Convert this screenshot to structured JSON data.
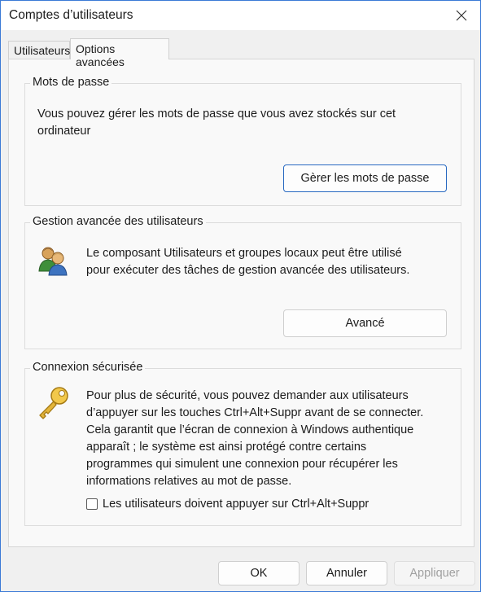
{
  "window": {
    "title": "Comptes d’utilisateurs",
    "accent_color": "#3b7ad6"
  },
  "tabs": [
    {
      "label": "Utilisateurs",
      "selected": false
    },
    {
      "label": "Options avancées",
      "selected": true
    }
  ],
  "passwords": {
    "title": "Mots de passe",
    "text_line1": "Vous pouvez gérer les mots de passe que vous avez stockés sur cet",
    "text_line2": "ordinateur",
    "button_label": "Gèrer les mots de passe"
  },
  "advanced_users": {
    "title": "Gestion avancée des utilisateurs",
    "icon": "users-group-icon",
    "text_line1": "Le composant Utilisateurs et groupes locaux peut être utilisé",
    "text_line2": "pour exécuter des tâches de gestion avancée des utilisateurs.",
    "button_label": "Avancé"
  },
  "secure_logon": {
    "title": "Connexion sécurisée",
    "icon": "key-icon",
    "text_lines": [
      "Pour plus de sécurité, vous pouvez demander aux utilisateurs",
      "d’appuyer sur les touches Ctrl+Alt+Suppr avant de se connecter.",
      "Cela garantit que l’écran de connexion à Windows authentique",
      "apparaît ; le système est ainsi protégé contre certains",
      "programmes qui simulent une connexion pour récupérer les",
      "informations relatives au mot de passe."
    ],
    "checkbox_label": "Les utilisateurs doivent appuyer sur Ctrl+Alt+Suppr",
    "checkbox_checked": false
  },
  "footer": {
    "ok_label": "OK",
    "cancel_label": "Annuler",
    "apply_label": "Appliquer",
    "apply_enabled": false
  }
}
